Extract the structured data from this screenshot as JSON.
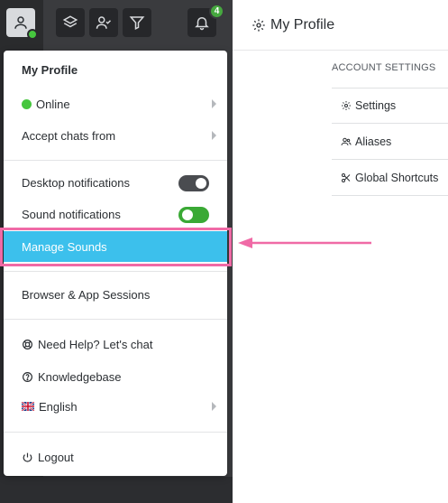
{
  "header": {
    "page_title": "My Profile",
    "notification_count": "4"
  },
  "account_settings": {
    "heading": "ACCOUNT SETTINGS",
    "items": [
      {
        "label": "Settings",
        "icon": "gear-icon"
      },
      {
        "label": "Aliases",
        "icon": "users-icon"
      },
      {
        "label": "Global Shortcuts",
        "icon": "scissors-icon"
      }
    ]
  },
  "menu": {
    "title": "My Profile",
    "status": "Online",
    "accept_chats": "Accept chats from",
    "desktop_notifications": {
      "label": "Desktop notifications",
      "enabled": true
    },
    "sound_notifications": {
      "label": "Sound notifications",
      "enabled": true
    },
    "manage_sounds": "Manage Sounds",
    "sessions": "Browser & App Sessions",
    "help": "Need Help? Let's chat",
    "knowledgebase": "Knowledgebase",
    "language": "English",
    "logout": "Logout"
  },
  "colors": {
    "highlight": "#3cc0ec",
    "annotation": "#f06aa6",
    "online": "#46c63e",
    "toggle_on": "#3aa935"
  }
}
